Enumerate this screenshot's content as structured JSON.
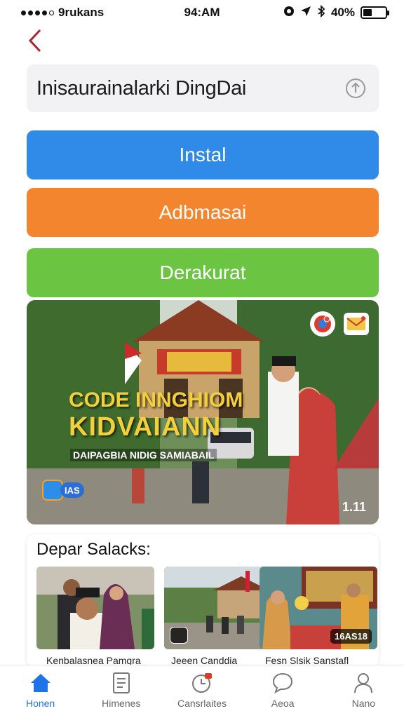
{
  "status_bar": {
    "carrier": "9rukans",
    "time": "94:AM",
    "battery": "40%",
    "battery_level": 0.4
  },
  "search": {
    "value": "Inisaurainalarki DingDai",
    "upload_icon": "upload-icon"
  },
  "buttons": {
    "install": "Instal",
    "admin": "Adbmasai",
    "derak": "Derakurat"
  },
  "colors": {
    "install": "#2f8ae8",
    "admin": "#f2852e",
    "derak": "#6cc443",
    "accent": "#1e73e8"
  },
  "hero": {
    "title_line1": "CODE INNGHIOM",
    "title_line2": "KIDVAIANN",
    "subtitle": "DAIPAGBIA NIDIG SAMIABAIL",
    "badge": "IAS",
    "corner": "1.11"
  },
  "section": {
    "title": "Depar Salacks:",
    "items": [
      {
        "caption": "Kenbalasnea Pamgra",
        "tag": ""
      },
      {
        "caption": "Jeeen Canddia",
        "tag": ""
      },
      {
        "caption": "Fesn Slsik Sanstafl",
        "tag": "16AS18"
      }
    ]
  },
  "tabs": [
    {
      "label": "Honen",
      "icon": "home-icon",
      "active": true
    },
    {
      "label": "Himenes",
      "icon": "document-icon",
      "active": false
    },
    {
      "label": "Cansrlaites",
      "icon": "calendar-icon",
      "active": false
    },
    {
      "label": "Aeoa",
      "icon": "chat-icon",
      "active": false
    },
    {
      "label": "Nano",
      "icon": "profile-icon",
      "active": false
    }
  ]
}
